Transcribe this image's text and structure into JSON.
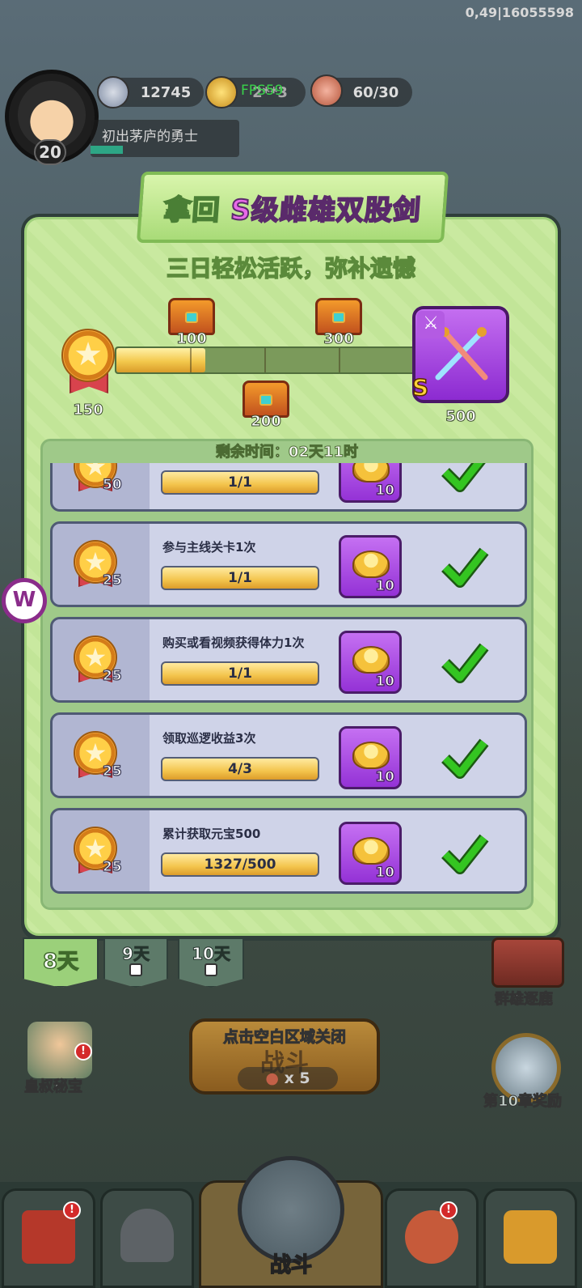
{
  "debug": {
    "text": "0,49|16055598",
    "fps": "FPS59"
  },
  "hud": {
    "level": "20",
    "player_title": "初出茅庐的勇士",
    "silver": "12745",
    "gold": "2**3",
    "stamina": "60/30"
  },
  "panel": {
    "title_prefix": "拿回",
    "title_highlight": "S级雌雄双股剑",
    "subtitle": "三日轻松活跃，弥补遗憾",
    "current_points": "150",
    "progress_fraction": 0.3,
    "milestones": [
      "100",
      "200",
      "300",
      "500"
    ],
    "final_reward_grade": "S",
    "timer": "剩余时间：02天11时"
  },
  "tasks": [
    {
      "points": "50",
      "task": "",
      "progress": "1/1",
      "reward": "10",
      "done": true
    },
    {
      "points": "25",
      "task": "参与主线关卡1次",
      "progress": "1/1",
      "reward": "10",
      "done": true
    },
    {
      "points": "25",
      "task": "购买或看视频获得体力1次",
      "progress": "1/1",
      "reward": "10",
      "done": true
    },
    {
      "points": "25",
      "task": "领取巡逻收益3次",
      "progress": "4/3",
      "reward": "10",
      "done": true
    },
    {
      "points": "25",
      "task": "累计获取元宝500",
      "progress": "1327/500",
      "reward": "10",
      "done": true
    }
  ],
  "tabs": [
    {
      "label": "8天",
      "locked": false,
      "active": true
    },
    {
      "label": "9天",
      "locked": true,
      "active": false
    },
    {
      "label": "10天",
      "locked": true,
      "active": false
    }
  ],
  "scene": {
    "left_label": "皇叔秘宝",
    "right_top_label": "群雄逐鹿",
    "right_label": "第10章奖励",
    "close_hint": "点击空白区域关闭",
    "fight_cost": "x 5",
    "fight_label": "战斗",
    "bottom_nav_center": "战斗"
  },
  "colors": {
    "panel_green": "#c9e9a0",
    "reward_purple": "#9432d6",
    "progress_gold": "#f3c84c",
    "check_green": "#34c521"
  }
}
